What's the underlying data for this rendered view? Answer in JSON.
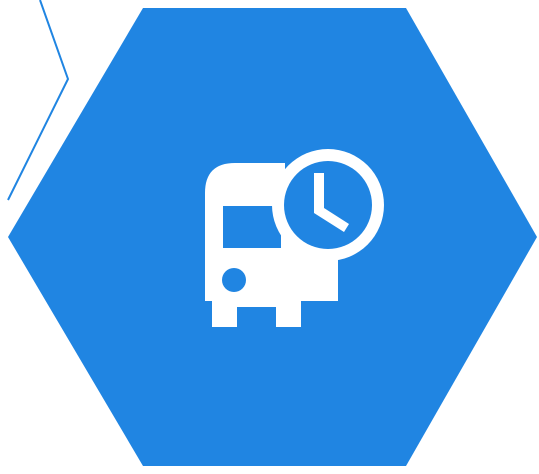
{
  "colors": {
    "background": "#ffffff",
    "hexagon_fill": "#2085E2",
    "outline_stroke": "#2085E2",
    "icon_fill": "#ffffff"
  },
  "icons": {
    "main": "bus-schedule-icon"
  }
}
